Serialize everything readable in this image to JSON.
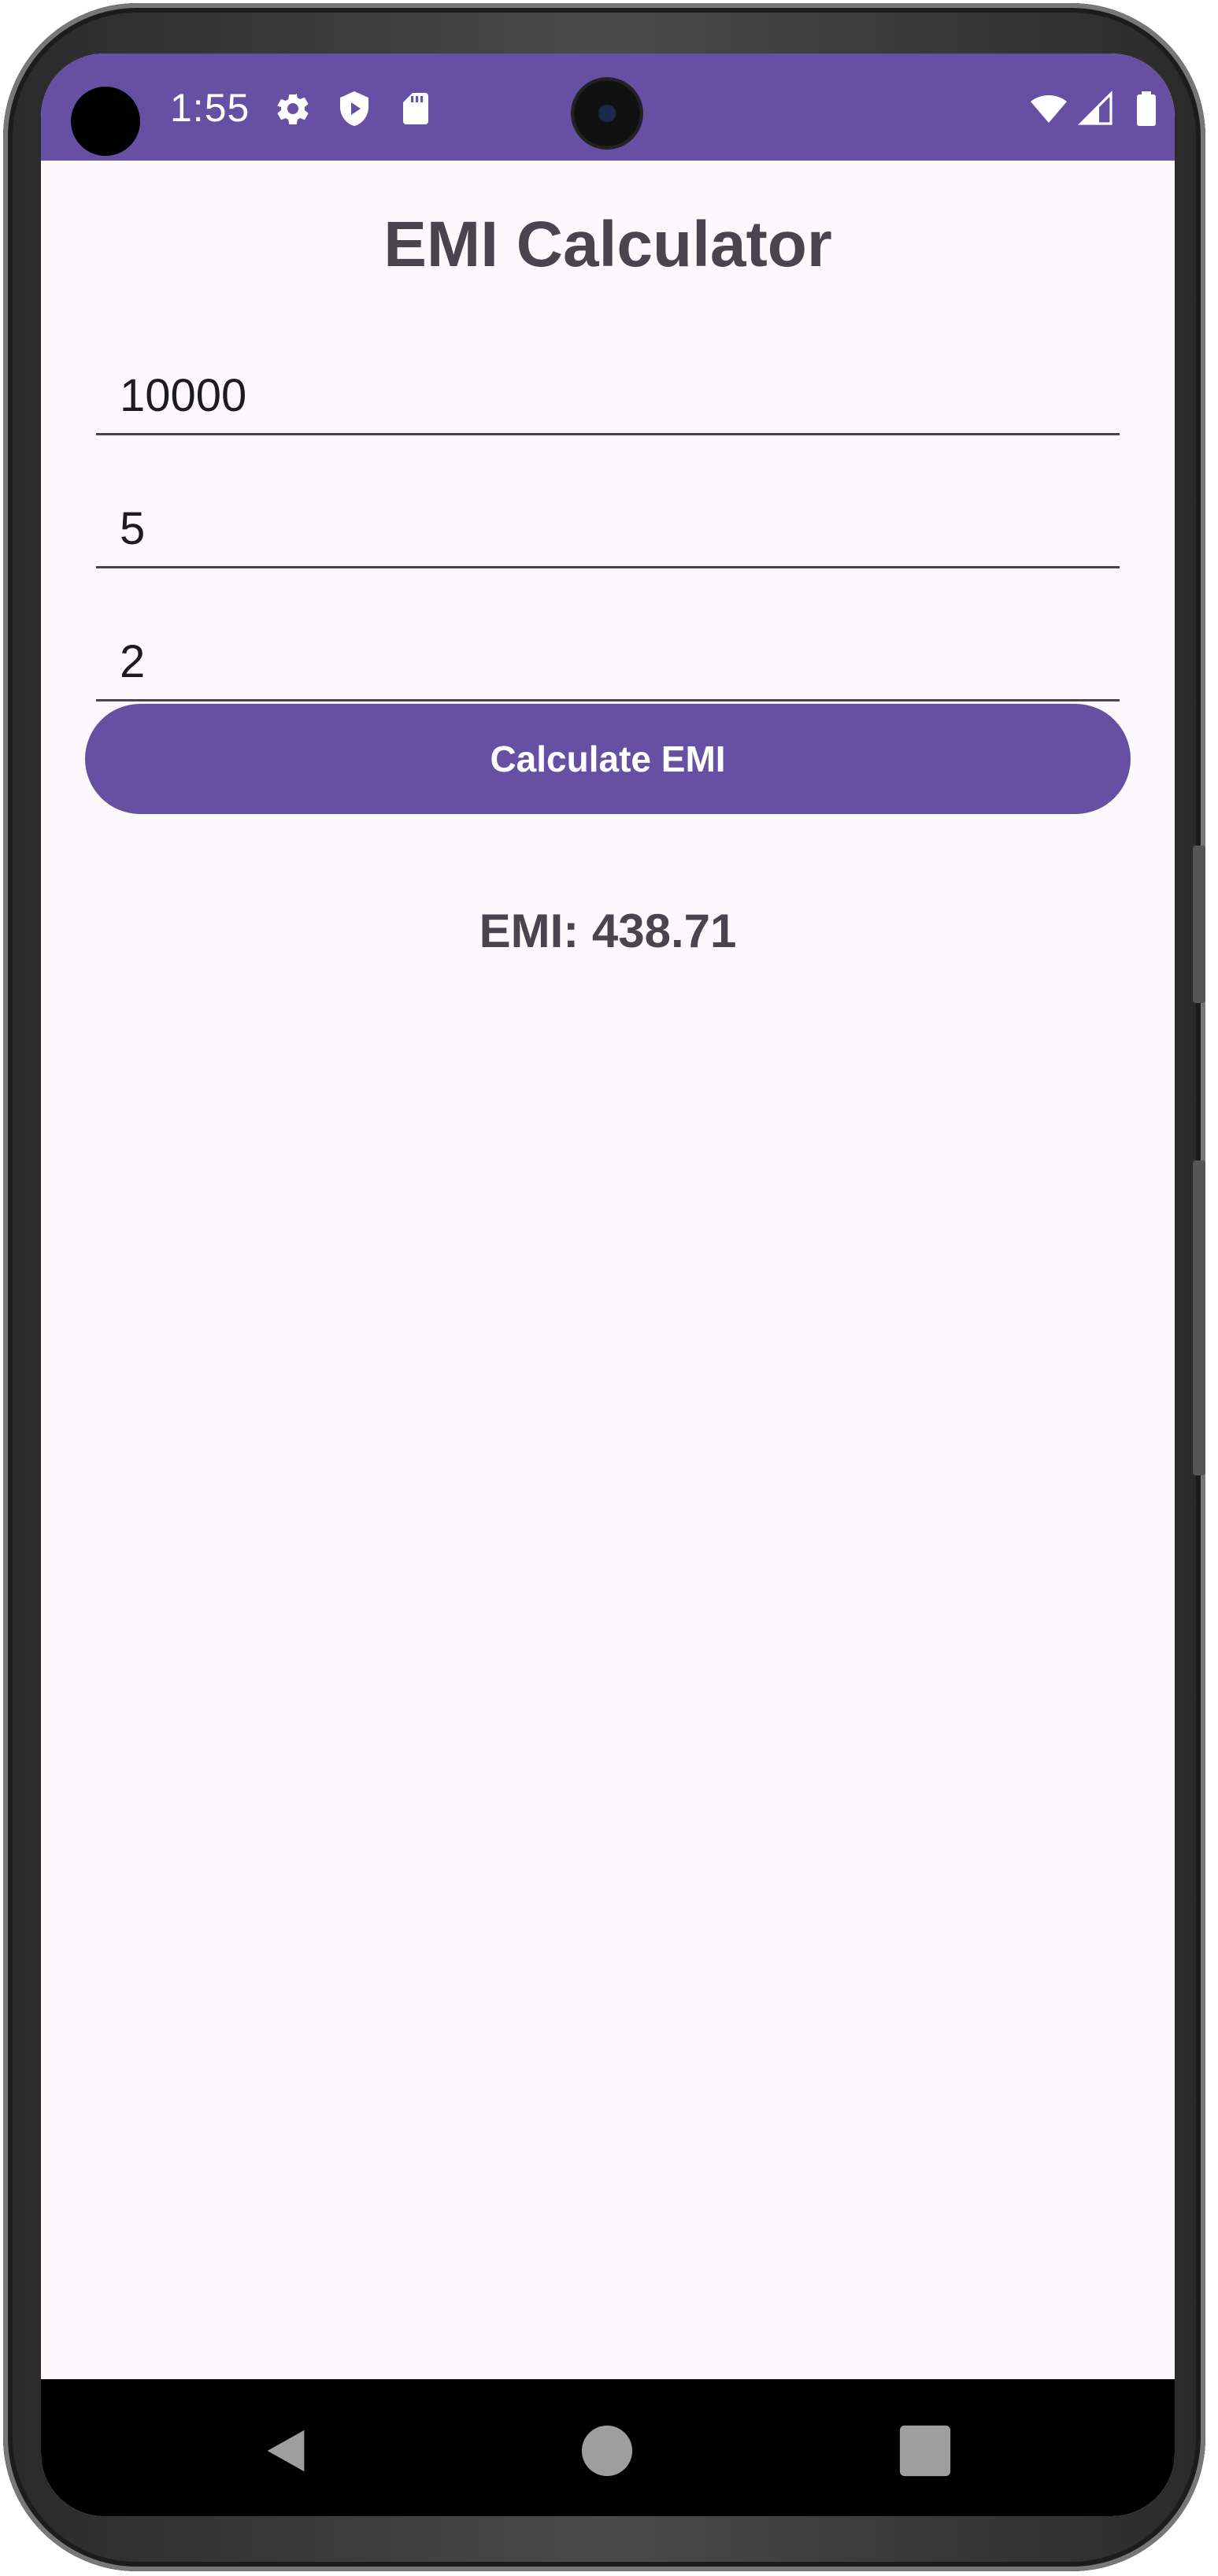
{
  "status_bar": {
    "time": "1:55",
    "background_color": "#6750a4",
    "left_icons": [
      "settings-icon",
      "shield-play-icon",
      "sd-card-icon"
    ],
    "right_icons": [
      "wifi-icon",
      "cellular-signal-icon",
      "battery-icon"
    ]
  },
  "app": {
    "title": "EMI Calculator",
    "fields": [
      {
        "name": "principal-field",
        "value": "10000"
      },
      {
        "name": "rate-field",
        "value": "5"
      },
      {
        "name": "tenure-field",
        "value": "2"
      }
    ],
    "button_label": "Calculate EMI",
    "result_text": "EMI: 438.71",
    "accent_color": "#6750a4"
  },
  "nav_bar": {
    "buttons": [
      "back-icon",
      "home-icon",
      "recents-icon"
    ]
  }
}
